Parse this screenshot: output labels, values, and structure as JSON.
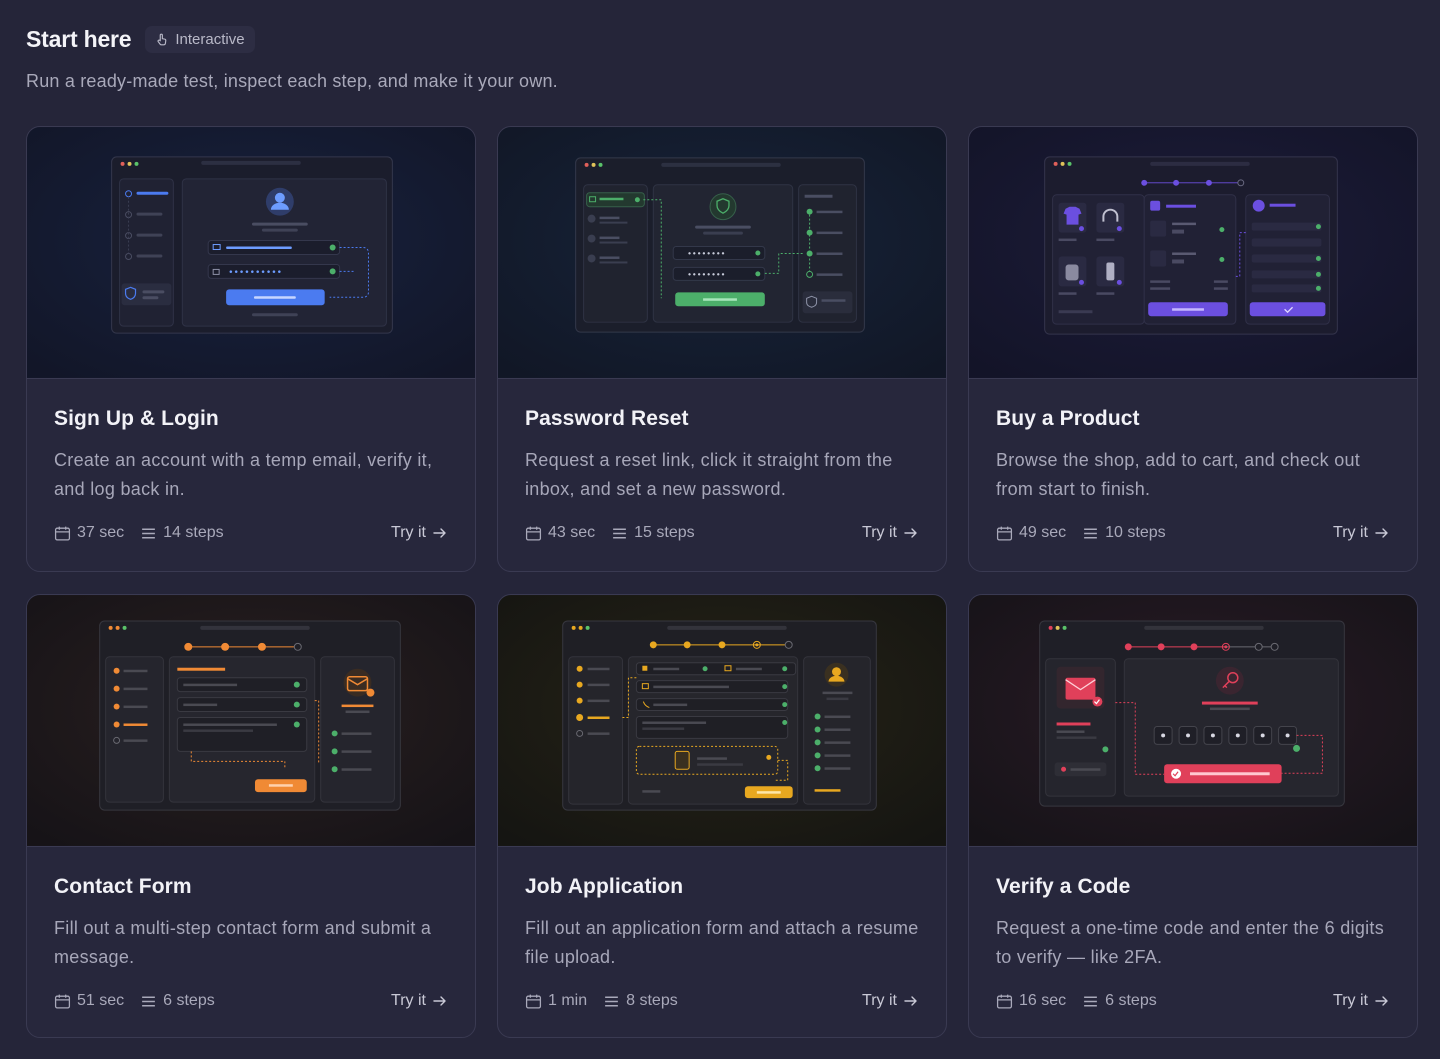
{
  "header": {
    "title": "Start here",
    "badge_label": "Interactive",
    "subtitle": "Run a ready-made test, inspect each step, and make it your own."
  },
  "cards": [
    {
      "title": "Sign Up & Login",
      "description": "Create an account with a temp email, verify it, and log back in.",
      "duration": "37 sec",
      "steps": "14 steps",
      "cta": "Try it",
      "accent": "#4b7bf0"
    },
    {
      "title": "Password Reset",
      "description": "Request a reset link, click it straight from the inbox, and set a new password.",
      "duration": "43 sec",
      "steps": "15 steps",
      "cta": "Try it",
      "accent": "#4caf6a"
    },
    {
      "title": "Buy a Product",
      "description": "Browse the shop, add to cart, and check out from start to finish.",
      "duration": "49 sec",
      "steps": "10 steps",
      "cta": "Try it",
      "accent": "#6b4fe0"
    },
    {
      "title": "Contact Form",
      "description": "Fill out a multi-step contact form and submit a message.",
      "duration": "51 sec",
      "steps": "6 steps",
      "cta": "Try it",
      "accent": "#f08a35"
    },
    {
      "title": "Job Application",
      "description": "Fill out an application form and attach a resume file upload.",
      "duration": "1 min",
      "steps": "8 steps",
      "cta": "Try it",
      "accent": "#e8a820"
    },
    {
      "title": "Verify a Code",
      "description": "Request a one-time code and enter the 6 digits to verify — like 2FA.",
      "duration": "16 sec",
      "steps": "6 steps",
      "cta": "Try it",
      "accent": "#e0405a"
    }
  ]
}
